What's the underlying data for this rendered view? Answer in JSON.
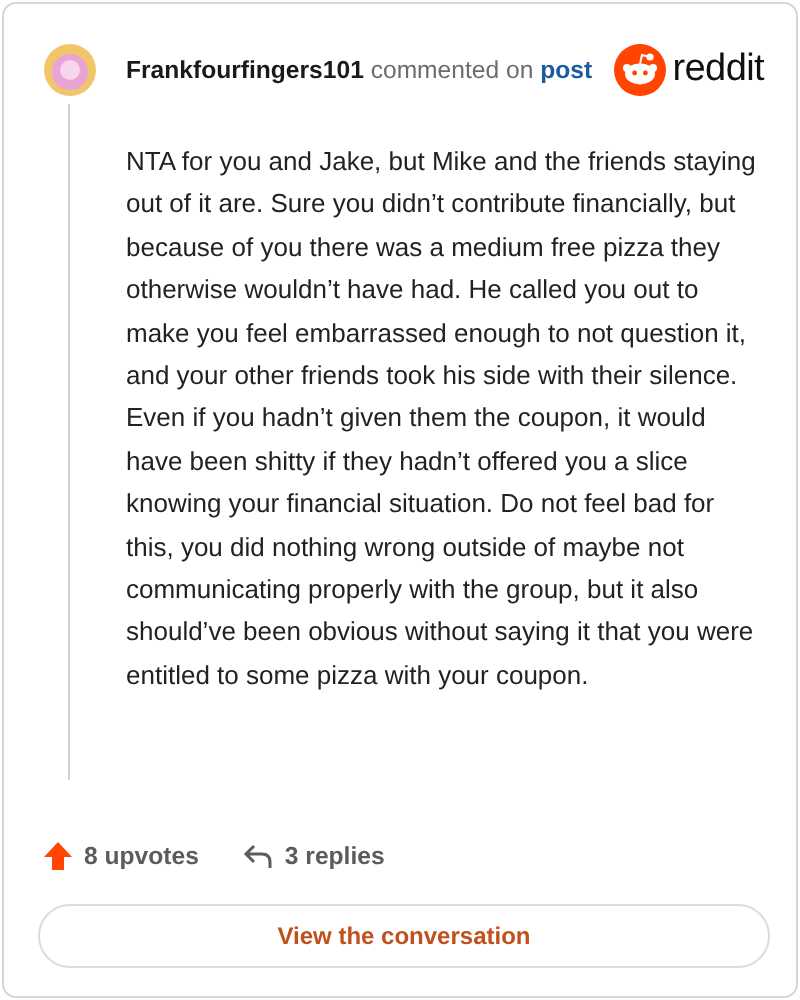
{
  "header": {
    "username": "Frankfourfingers101",
    "action": "commented on",
    "link": "post",
    "brand": "reddit"
  },
  "comment": {
    "body": "NTA for you and Jake, but Mike and the friends staying out of it are. Sure you didn’t contribute financially, but because of you there was a medium free pizza they otherwise wouldn’t have had. He called you out to make you feel embarrassed enough to not question it, and your other friends took his side with their silence. Even if you hadn’t given them the coupon, it would have been shitty if they hadn’t offered you a slice knowing your financial situation. Do not feel bad for this, you did nothing wrong outside of maybe not communicating properly with the group, but it also should’ve been obvious without saying it that you were entitled to some pizza with your coupon."
  },
  "footer": {
    "upvotes": "8 upvotes",
    "replies": "3 replies",
    "button": "View the conversation"
  }
}
